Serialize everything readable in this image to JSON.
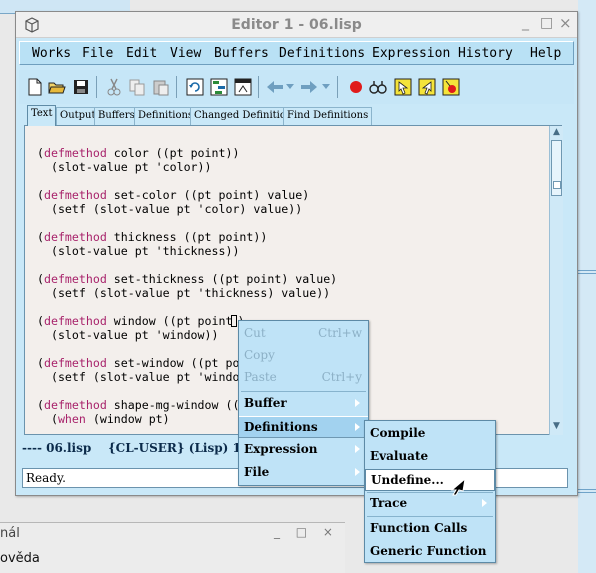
{
  "window": {
    "title": "Editor 1 - 06.lisp",
    "controls": {
      "minimize": "_",
      "maximize": "□",
      "close": "×"
    }
  },
  "menubar": {
    "items": [
      "Works",
      "File",
      "Edit",
      "View",
      "Buffers",
      "Definitions",
      "Expression",
      "History",
      "Help"
    ]
  },
  "toolbar": {
    "buttons": [
      "new-file-icon",
      "open-folder-icon",
      "save-icon",
      "cut-icon",
      "copy-icon",
      "paste-icon",
      "refresh-icon",
      "structure-icon",
      "dialog-icon",
      "back-arrow-icon",
      "back-dropdown-icon",
      "forward-arrow-icon",
      "forward-dropdown-icon",
      "stop-icon",
      "inspect-icon",
      "pointer-icon",
      "pointer-alt-icon",
      "debug-icon"
    ]
  },
  "tabs": [
    "Text",
    "Output",
    "Buffers",
    "Definitions",
    "Changed Definitions",
    "Find Definitions"
  ],
  "editor": {
    "lines": [
      [
        "defmethod",
        " color ((pt point))"
      ],
      [
        "",
        "  (slot-value pt 'color))"
      ],
      [
        "",
        ""
      ],
      [
        "defmethod",
        " set-color ((pt point) value)"
      ],
      [
        "",
        "  (setf (slot-value pt 'color) value))"
      ],
      [
        "",
        ""
      ],
      [
        "defmethod",
        " thickness ((pt point))"
      ],
      [
        "",
        "  (slot-value pt 'thickness))"
      ],
      [
        "",
        ""
      ],
      [
        "defmethod",
        " set-thickness ((pt point) value)"
      ],
      [
        "",
        "  (setf (slot-value pt 'thickness) value))"
      ],
      [
        "",
        ""
      ],
      [
        "defmethod",
        " window ((pt point"
      ],
      [
        "",
        "  (slot-value pt 'window))"
      ],
      [
        "",
        ""
      ],
      [
        "defmethod",
        " set-window ((pt po"
      ],
      [
        "",
        "  (setf (slot-value pt 'windo"
      ],
      [
        "",
        ""
      ],
      [
        "defmethod",
        " shape-mg-window (("
      ],
      [
        "when",
        " (window pt)"
      ]
    ]
  },
  "mode_line": "---- 06.lisp    {CL-USER} (Lisp) 13+",
  "status": "Ready.",
  "context_menu": {
    "items": [
      {
        "label": "Cut",
        "shortcut": "Ctrl+w",
        "disabled": true
      },
      {
        "label": "Copy",
        "shortcut": "",
        "disabled": true
      },
      {
        "label": "Paste",
        "shortcut": "Ctrl+y",
        "disabled": true
      },
      {
        "label": "Buffer",
        "submenu": true
      },
      {
        "label": "Definitions",
        "submenu": true,
        "highlighted": true
      },
      {
        "label": "Expression",
        "submenu": true
      },
      {
        "label": "File",
        "submenu": true
      }
    ]
  },
  "definitions_submenu": {
    "items": [
      {
        "label": "Compile"
      },
      {
        "label": "Evaluate"
      },
      {
        "label": "Undefine...",
        "highlighted": true
      },
      {
        "label": "Trace",
        "submenu": true
      },
      {
        "label": "Function Calls"
      },
      {
        "label": "Generic Function"
      }
    ]
  },
  "background": {
    "lower_window_title": "nál",
    "lower_window_menu": "ověda"
  },
  "colors": {
    "window_bg": "#c9e8f8",
    "keyword": "#a8236b",
    "code_bg": "#f3efec",
    "menu_bg": "#bfe3f7"
  }
}
